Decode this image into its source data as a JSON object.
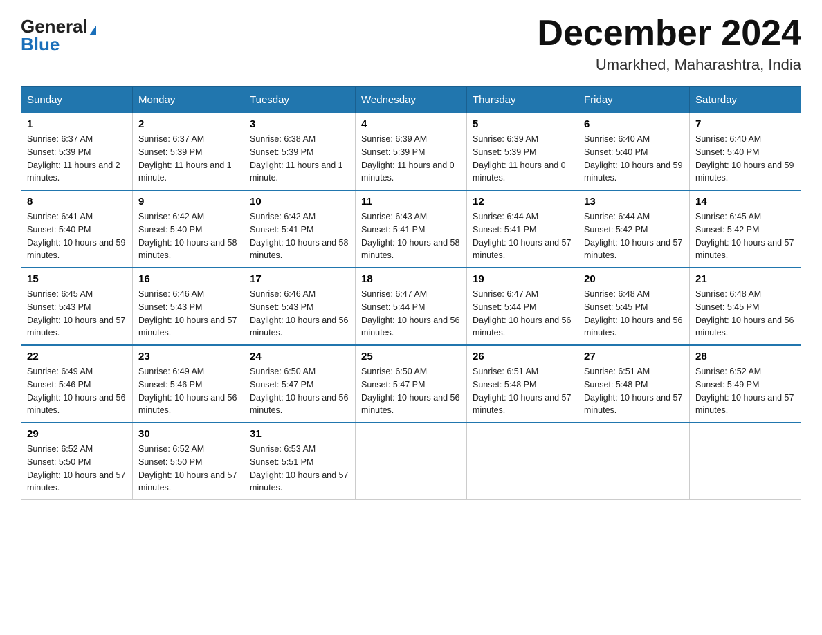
{
  "header": {
    "logo_general": "General",
    "logo_blue": "Blue",
    "month_title": "December 2024",
    "subtitle": "Umarkhed, Maharashtra, India"
  },
  "days_of_week": [
    "Sunday",
    "Monday",
    "Tuesday",
    "Wednesday",
    "Thursday",
    "Friday",
    "Saturday"
  ],
  "weeks": [
    [
      {
        "day": "1",
        "sunrise": "6:37 AM",
        "sunset": "5:39 PM",
        "daylight": "11 hours and 2 minutes."
      },
      {
        "day": "2",
        "sunrise": "6:37 AM",
        "sunset": "5:39 PM",
        "daylight": "11 hours and 1 minute."
      },
      {
        "day": "3",
        "sunrise": "6:38 AM",
        "sunset": "5:39 PM",
        "daylight": "11 hours and 1 minute."
      },
      {
        "day": "4",
        "sunrise": "6:39 AM",
        "sunset": "5:39 PM",
        "daylight": "11 hours and 0 minutes."
      },
      {
        "day": "5",
        "sunrise": "6:39 AM",
        "sunset": "5:39 PM",
        "daylight": "11 hours and 0 minutes."
      },
      {
        "day": "6",
        "sunrise": "6:40 AM",
        "sunset": "5:40 PM",
        "daylight": "10 hours and 59 minutes."
      },
      {
        "day": "7",
        "sunrise": "6:40 AM",
        "sunset": "5:40 PM",
        "daylight": "10 hours and 59 minutes."
      }
    ],
    [
      {
        "day": "8",
        "sunrise": "6:41 AM",
        "sunset": "5:40 PM",
        "daylight": "10 hours and 59 minutes."
      },
      {
        "day": "9",
        "sunrise": "6:42 AM",
        "sunset": "5:40 PM",
        "daylight": "10 hours and 58 minutes."
      },
      {
        "day": "10",
        "sunrise": "6:42 AM",
        "sunset": "5:41 PM",
        "daylight": "10 hours and 58 minutes."
      },
      {
        "day": "11",
        "sunrise": "6:43 AM",
        "sunset": "5:41 PM",
        "daylight": "10 hours and 58 minutes."
      },
      {
        "day": "12",
        "sunrise": "6:44 AM",
        "sunset": "5:41 PM",
        "daylight": "10 hours and 57 minutes."
      },
      {
        "day": "13",
        "sunrise": "6:44 AM",
        "sunset": "5:42 PM",
        "daylight": "10 hours and 57 minutes."
      },
      {
        "day": "14",
        "sunrise": "6:45 AM",
        "sunset": "5:42 PM",
        "daylight": "10 hours and 57 minutes."
      }
    ],
    [
      {
        "day": "15",
        "sunrise": "6:45 AM",
        "sunset": "5:43 PM",
        "daylight": "10 hours and 57 minutes."
      },
      {
        "day": "16",
        "sunrise": "6:46 AM",
        "sunset": "5:43 PM",
        "daylight": "10 hours and 57 minutes."
      },
      {
        "day": "17",
        "sunrise": "6:46 AM",
        "sunset": "5:43 PM",
        "daylight": "10 hours and 56 minutes."
      },
      {
        "day": "18",
        "sunrise": "6:47 AM",
        "sunset": "5:44 PM",
        "daylight": "10 hours and 56 minutes."
      },
      {
        "day": "19",
        "sunrise": "6:47 AM",
        "sunset": "5:44 PM",
        "daylight": "10 hours and 56 minutes."
      },
      {
        "day": "20",
        "sunrise": "6:48 AM",
        "sunset": "5:45 PM",
        "daylight": "10 hours and 56 minutes."
      },
      {
        "day": "21",
        "sunrise": "6:48 AM",
        "sunset": "5:45 PM",
        "daylight": "10 hours and 56 minutes."
      }
    ],
    [
      {
        "day": "22",
        "sunrise": "6:49 AM",
        "sunset": "5:46 PM",
        "daylight": "10 hours and 56 minutes."
      },
      {
        "day": "23",
        "sunrise": "6:49 AM",
        "sunset": "5:46 PM",
        "daylight": "10 hours and 56 minutes."
      },
      {
        "day": "24",
        "sunrise": "6:50 AM",
        "sunset": "5:47 PM",
        "daylight": "10 hours and 56 minutes."
      },
      {
        "day": "25",
        "sunrise": "6:50 AM",
        "sunset": "5:47 PM",
        "daylight": "10 hours and 56 minutes."
      },
      {
        "day": "26",
        "sunrise": "6:51 AM",
        "sunset": "5:48 PM",
        "daylight": "10 hours and 57 minutes."
      },
      {
        "day": "27",
        "sunrise": "6:51 AM",
        "sunset": "5:48 PM",
        "daylight": "10 hours and 57 minutes."
      },
      {
        "day": "28",
        "sunrise": "6:52 AM",
        "sunset": "5:49 PM",
        "daylight": "10 hours and 57 minutes."
      }
    ],
    [
      {
        "day": "29",
        "sunrise": "6:52 AM",
        "sunset": "5:50 PM",
        "daylight": "10 hours and 57 minutes."
      },
      {
        "day": "30",
        "sunrise": "6:52 AM",
        "sunset": "5:50 PM",
        "daylight": "10 hours and 57 minutes."
      },
      {
        "day": "31",
        "sunrise": "6:53 AM",
        "sunset": "5:51 PM",
        "daylight": "10 hours and 57 minutes."
      },
      null,
      null,
      null,
      null
    ]
  ],
  "labels": {
    "sunrise": "Sunrise:",
    "sunset": "Sunset:",
    "daylight": "Daylight:"
  }
}
